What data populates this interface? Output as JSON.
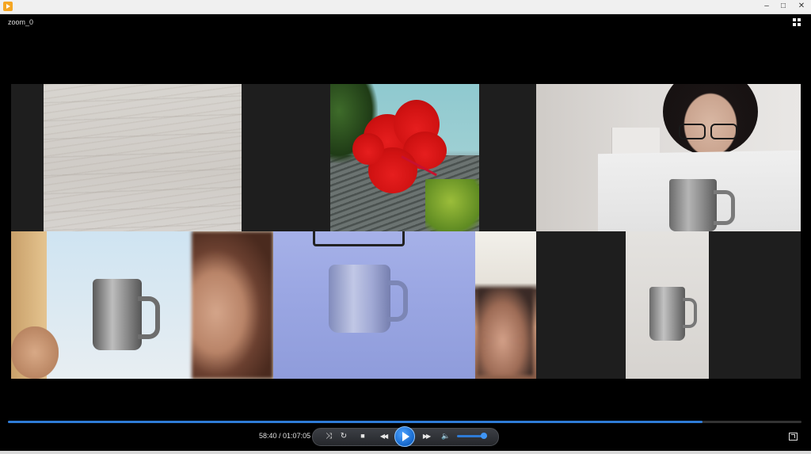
{
  "window": {
    "minimize_glyph": "–",
    "maximize_glyph": "□",
    "close_glyph": "✕"
  },
  "video": {
    "title": "zoom_0"
  },
  "playback": {
    "elapsed": "58:40",
    "separator": " / ",
    "duration": "01:07:05",
    "progress_fraction": 0.875,
    "volume_fraction": 0.8
  },
  "controls": {
    "shuffle_glyph": "⤨",
    "repeat_glyph": "↻",
    "stop_glyph": "■",
    "rewind_glyph": "◀◀",
    "forward_glyph": "▶▶",
    "volume_glyph": "🔈"
  },
  "colors": {
    "accent": "#2e7bd6",
    "background": "#000000"
  },
  "icons": [
    "app-icon",
    "grid-view-icon",
    "shuffle-icon",
    "repeat-icon",
    "stop-icon",
    "rewind-icon",
    "play-icon",
    "fast-forward-icon",
    "volume-icon",
    "fullscreen-icon"
  ]
}
